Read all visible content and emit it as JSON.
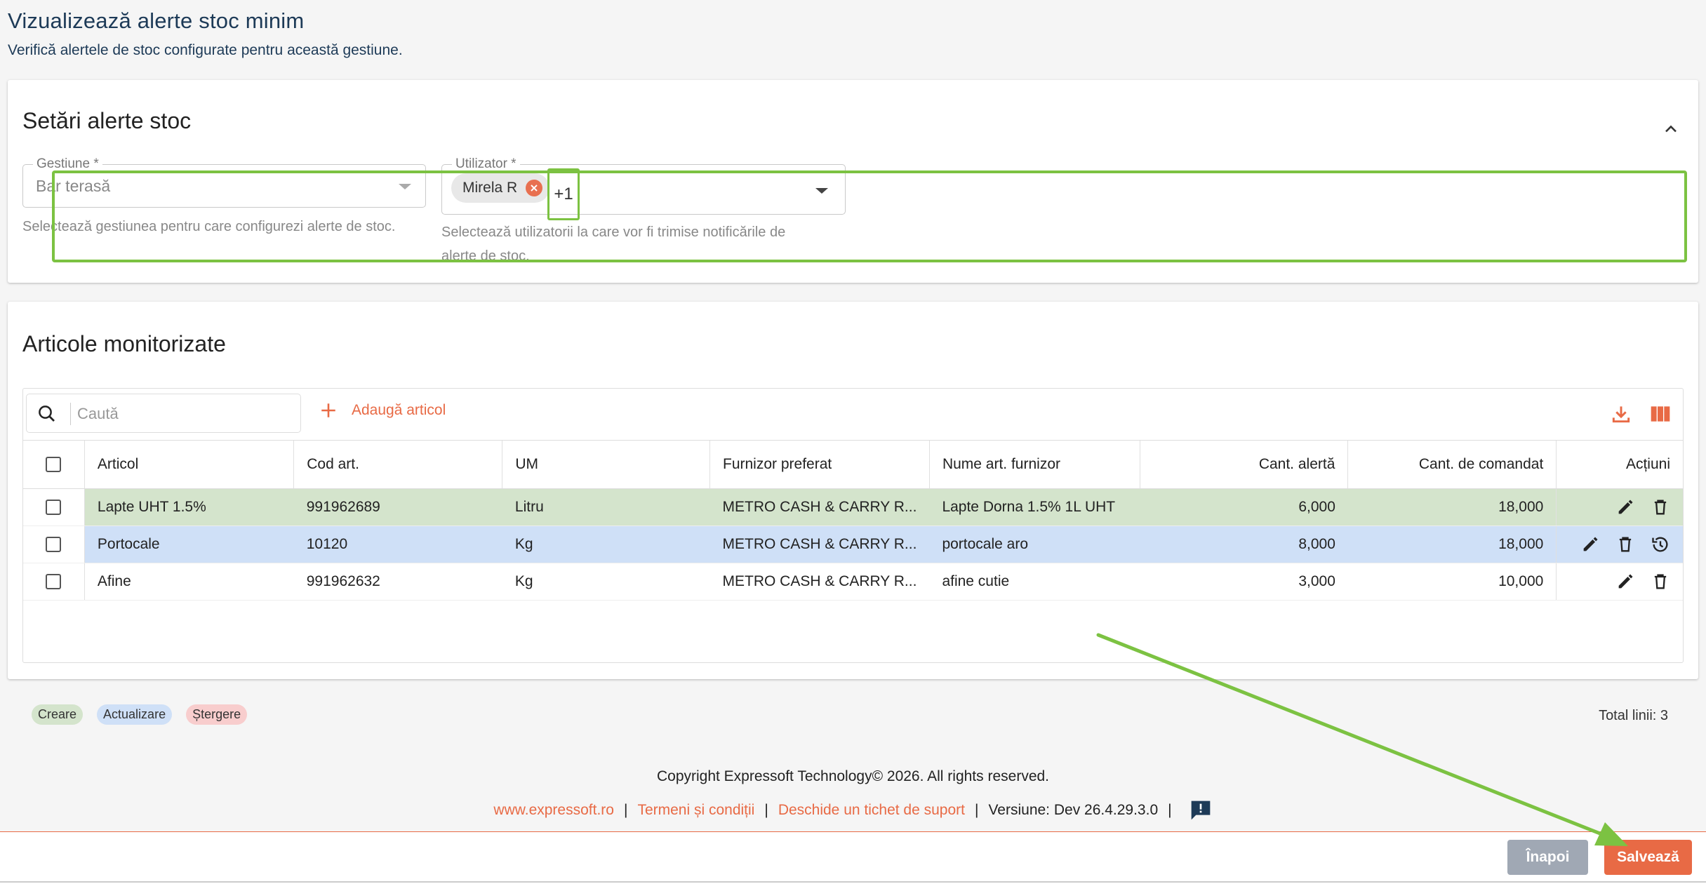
{
  "page": {
    "title": "Vizualizează alerte stoc minim",
    "subtitle": "Verifică alertele de stoc configurate pentru această gestiune."
  },
  "settings": {
    "title": "Setări alerte stoc",
    "gestiune": {
      "label": "Gestiune *",
      "value": "Bar terasă",
      "help": "Selectează gestiunea pentru care configurezi alerte de stoc."
    },
    "utilizator": {
      "label": "Utilizator *",
      "chip": "Mirela R",
      "more": "+1",
      "help_line1": "Selectează utilizatorii la care vor fi trimise notificările de",
      "help_line2": "alerte de stoc."
    }
  },
  "articles": {
    "title": "Articole monitorizate",
    "search_placeholder": "Caută",
    "add_label": "Adaugă articol",
    "columns": [
      "Articol",
      "Cod art.",
      "UM",
      "Furnizor preferat",
      "Nume art. furnizor",
      "Cant. alertă",
      "Cant. de comandat",
      "Acțiuni"
    ],
    "rows": [
      {
        "articol": "Lapte UHT 1.5%",
        "cod": "991962689",
        "um": "Litru",
        "furnizor": "METRO CASH & CARRY R...",
        "nume_furnizor": "Lapte Dorna 1.5% 1L UHT",
        "alerta": "6,000",
        "comandat": "18,000",
        "status": "create"
      },
      {
        "articol": "Portocale",
        "cod": "10120",
        "um": "Kg",
        "furnizor": "METRO CASH & CARRY R...",
        "nume_furnizor": "portocale aro",
        "alerta": "8,000",
        "comandat": "18,000",
        "status": "update"
      },
      {
        "articol": "Afine",
        "cod": "991962632",
        "um": "Kg",
        "furnizor": "METRO CASH & CARRY R...",
        "nume_furnizor": "afine cutie",
        "alerta": "3,000",
        "comandat": "10,000",
        "status": "none"
      }
    ],
    "legend": {
      "create": "Creare",
      "update": "Actualizare",
      "delete": "Ștergere"
    },
    "total": "Total linii: 3"
  },
  "footer": {
    "copyright": "Copyright Expressoft Technology© 2026. All rights reserved.",
    "link_site": "www.expressoft.ro",
    "link_terms": "Termeni și condiții",
    "link_ticket": "Deschide un tichet de suport",
    "version": "Versiune: Dev 26.4.29.3.0"
  },
  "actions": {
    "back": "Înapoi",
    "save": "Salvează"
  },
  "colors": {
    "accent": "#e86a45",
    "highlight": "#7cc242",
    "create_row": "#d4e4cc",
    "update_row": "#cfe0f7",
    "delete_badge": "#f8cdcd"
  }
}
